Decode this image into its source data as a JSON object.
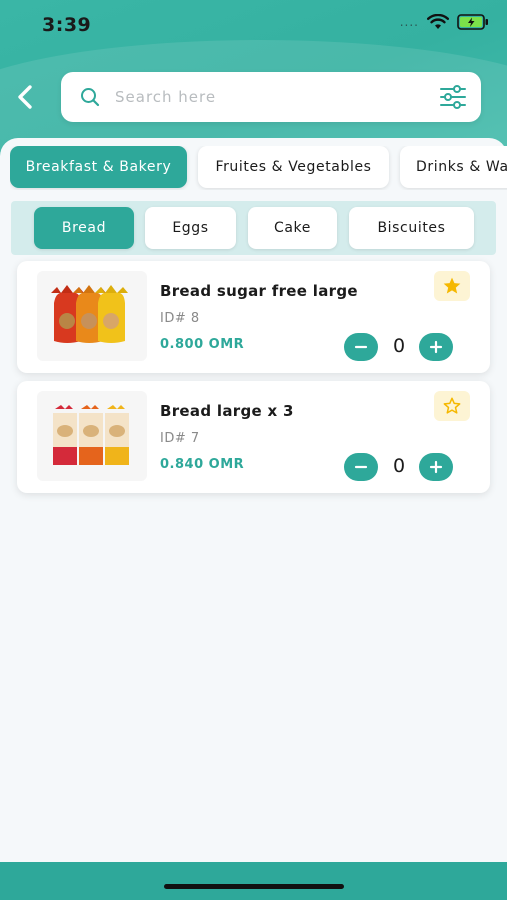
{
  "status_bar": {
    "time": "3:39",
    "dots": "....",
    "icons": [
      "wifi-icon",
      "battery-icon"
    ]
  },
  "header": {
    "back_icon": "chevron-left-icon",
    "search": {
      "placeholder": "Search here",
      "value": "",
      "icon": "search-icon",
      "filter_icon": "sliders-icon"
    }
  },
  "categories": [
    {
      "label": "Breakfast & Bakery",
      "active": true
    },
    {
      "label": "Fruites & Vegetables",
      "active": false
    },
    {
      "label": "Drinks & Wa",
      "active": false
    }
  ],
  "subcategories": [
    {
      "label": "Bread",
      "active": true
    },
    {
      "label": "Eggs",
      "active": false
    },
    {
      "label": "Cake",
      "active": false
    },
    {
      "label": "Biscuites",
      "active": false
    }
  ],
  "products": [
    {
      "name": "Bread sugar free large",
      "id": "ID# 8",
      "price": "0.800 OMR",
      "quantity": "0",
      "favorite": true
    },
    {
      "name": "Bread large x 3",
      "id": "ID# 7",
      "price": "0.840 OMR",
      "quantity": "0",
      "favorite": false
    }
  ],
  "colors": {
    "accent": "#2ea89a",
    "header_teal": "#3ab6a6",
    "star_yellow": "#f5b800",
    "favorite_bg": "#fdf4d4",
    "subbar_bg": "#d4ecec"
  }
}
